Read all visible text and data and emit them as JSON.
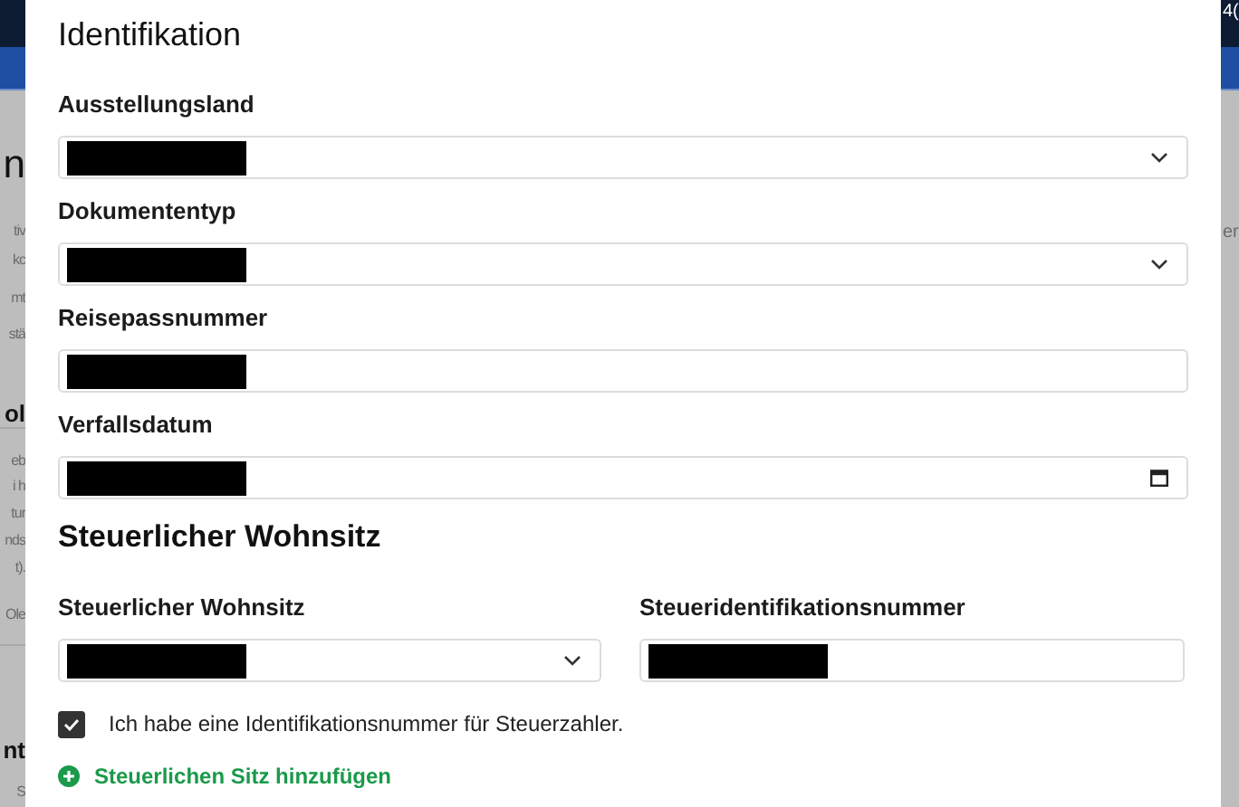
{
  "background": {
    "left_fragments": [
      {
        "text": "n",
        "kind": "heading"
      },
      {
        "text": "tiv",
        "kind": "text"
      },
      {
        "text": "kc",
        "kind": "text"
      },
      {
        "text": "mt",
        "kind": "text"
      },
      {
        "text": "stä",
        "kind": "text"
      },
      {
        "text": "ol",
        "kind": "heading"
      },
      {
        "text": "eb",
        "kind": "text"
      },
      {
        "text": "i h",
        "kind": "text"
      },
      {
        "text": "tur",
        "kind": "text"
      },
      {
        "text": "nds",
        "kind": "text"
      },
      {
        "text": "t).",
        "kind": "text"
      },
      {
        "text": "Ole",
        "kind": "text"
      },
      {
        "text": "nt",
        "kind": "heading"
      },
      {
        "text": "S",
        "kind": "text"
      }
    ],
    "right_fragments": [
      {
        "text": "4(",
        "kind": "header"
      },
      {
        "text": "er",
        "kind": "text"
      }
    ]
  },
  "title": "Identifikation",
  "fields": [
    {
      "kind": "select",
      "label": "Ausstellungsland",
      "redacted": true
    },
    {
      "kind": "select",
      "label": "Dokumententyp",
      "redacted": true
    },
    {
      "kind": "text",
      "label": "Reisepassnummer",
      "redacted": true
    },
    {
      "kind": "date",
      "label": "Verfallsdatum",
      "redacted": true
    }
  ],
  "tax_section": {
    "heading": "Steuerlicher Wohnsitz",
    "fields": [
      {
        "kind": "select",
        "label": "Steuerlicher Wohnsitz",
        "redacted": true
      },
      {
        "kind": "text",
        "label": "Steueridentifikationsnummer",
        "redacted": true
      }
    ],
    "checkbox": {
      "label": "Ich habe eine Identifikationsnummer für Steuerzahler.",
      "checked": true
    },
    "add_link": "Steuerlichen Sitz hinzufügen"
  }
}
